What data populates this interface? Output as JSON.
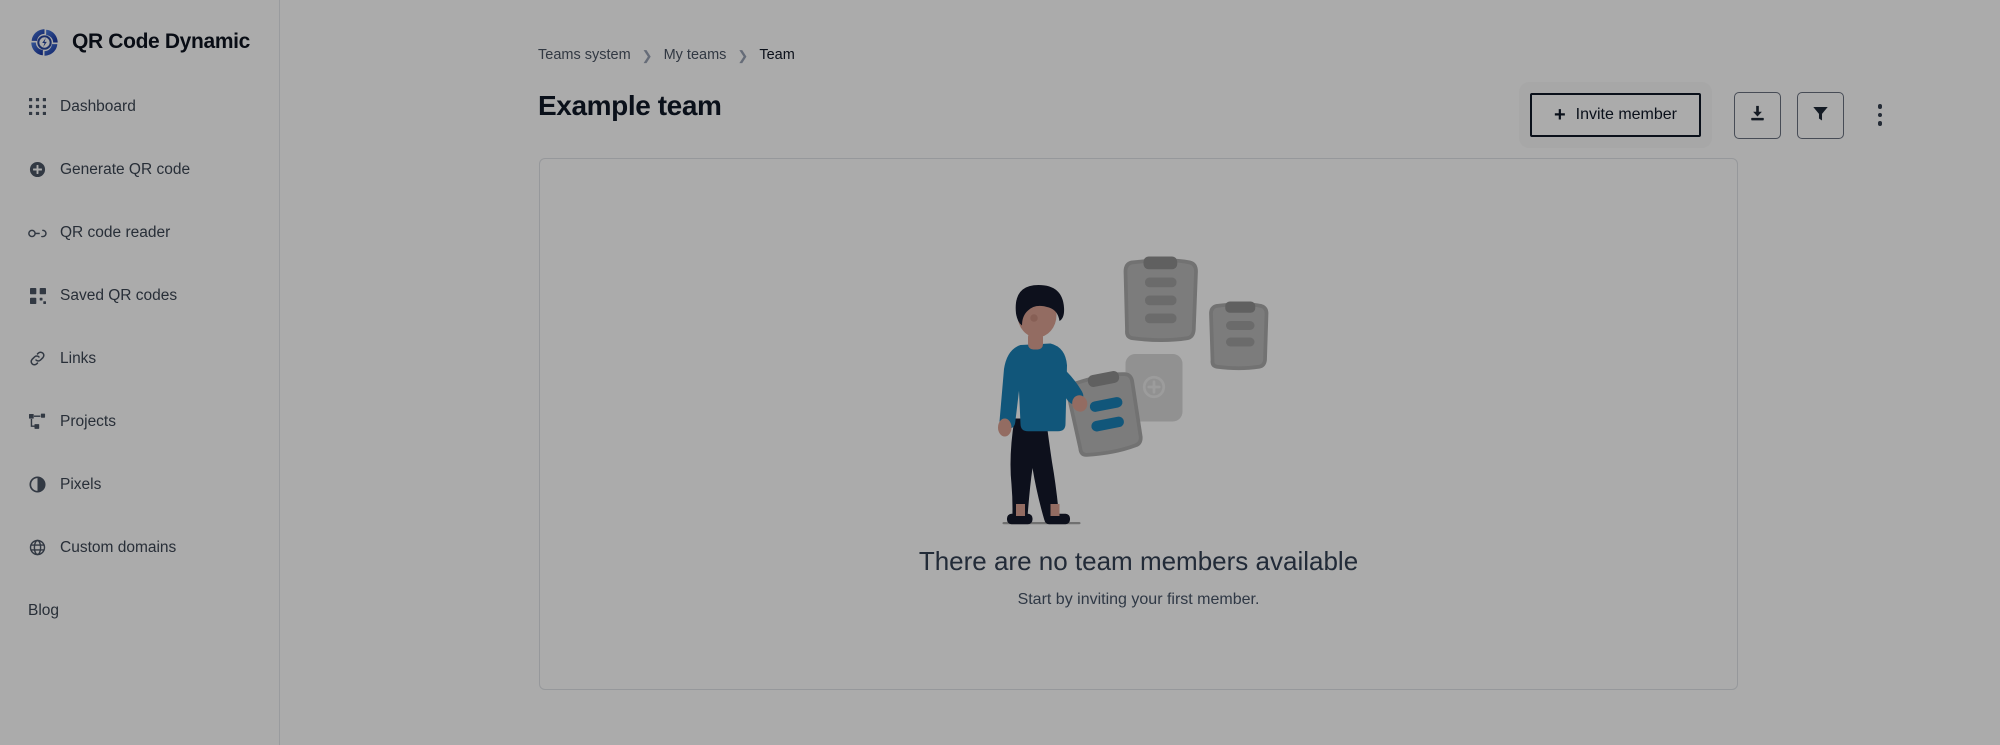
{
  "brand": {
    "name": "QR Code Dynamic",
    "logo_icon": "qr-dynamic-swirl-logo",
    "logo_color": "#2a52be"
  },
  "sidebar": {
    "items": [
      {
        "label": "Dashboard",
        "icon": "grid-icon"
      },
      {
        "label": "Generate QR code",
        "icon": "plus-circle-icon"
      },
      {
        "label": "QR code reader",
        "icon": "glasses-icon"
      },
      {
        "label": "Saved QR codes",
        "icon": "qr-grid-icon"
      },
      {
        "label": "Links",
        "icon": "link-icon"
      },
      {
        "label": "Projects",
        "icon": "sitemap-icon"
      },
      {
        "label": "Pixels",
        "icon": "half-circle-icon"
      },
      {
        "label": "Custom domains",
        "icon": "globe-icon"
      },
      {
        "label": "Blog",
        "icon": ""
      }
    ]
  },
  "breadcrumb": {
    "separator": "❯",
    "items": [
      {
        "label": "Teams system",
        "current": false
      },
      {
        "label": "My teams",
        "current": false
      },
      {
        "label": "Team",
        "current": true
      }
    ]
  },
  "header": {
    "title": "Example team"
  },
  "toolbar": {
    "invite_label": "Invite member",
    "invite_plus": "+",
    "invite_icon": "plus-icon",
    "download_icon": "download-icon",
    "filter_icon": "filter-funnel-icon",
    "more_icon": "more-vertical-icon"
  },
  "empty_state": {
    "illustration": "person-with-clipboards-illustration",
    "title": "There are no team members available",
    "subtitle": "Start by inviting your first member.",
    "accent_color": "#1a80b6",
    "muted_color": "#b6b6b6"
  }
}
